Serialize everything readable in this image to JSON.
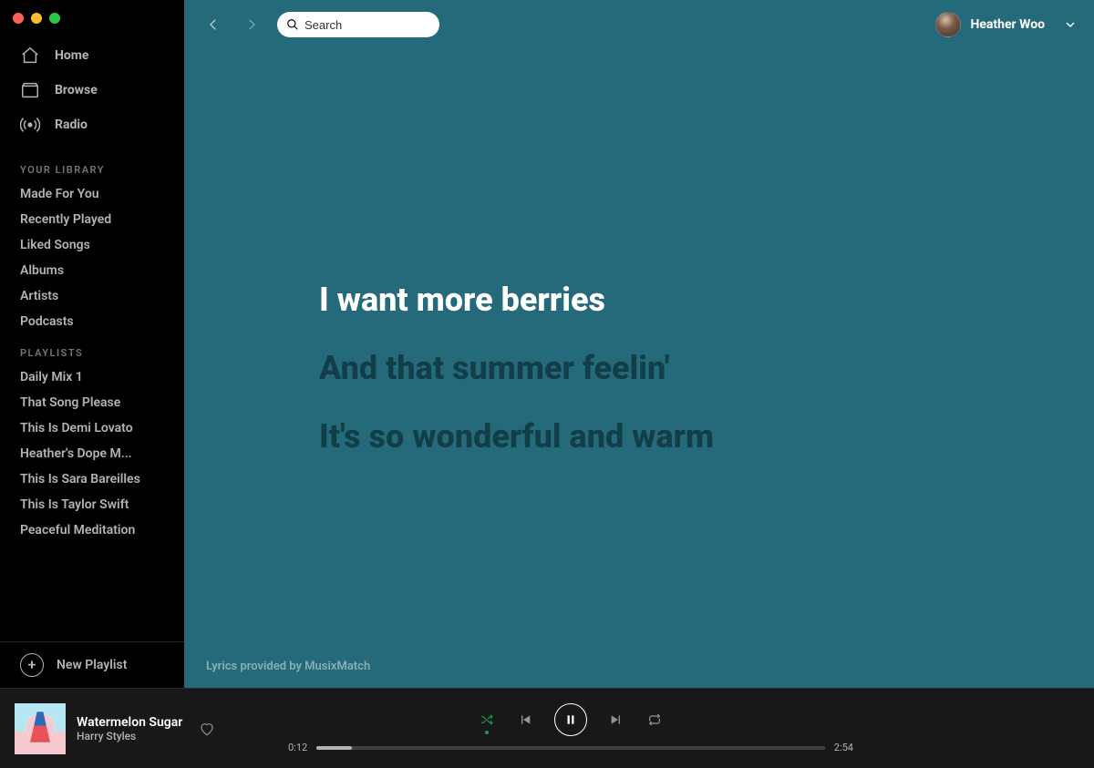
{
  "sidebar": {
    "nav": [
      {
        "label": "Home",
        "icon": "home-icon",
        "active": false
      },
      {
        "label": "Browse",
        "icon": "browse-icon",
        "active": false
      },
      {
        "label": "Radio",
        "icon": "radio-icon",
        "active": false
      }
    ],
    "library_title": "YOUR LIBRARY",
    "library": [
      "Made For You",
      "Recently Played",
      "Liked Songs",
      "Albums",
      "Artists",
      "Podcasts"
    ],
    "playlists_title": "PLAYLISTS",
    "playlists": [
      "Daily Mix 1",
      "That Song Please",
      "This Is Demi Lovato",
      "Heather's Dope M...",
      "This Is Sara Bareilles",
      "This Is Taylor Swift",
      "Peaceful Meditation"
    ],
    "new_playlist": "New Playlist"
  },
  "topbar": {
    "search_placeholder": "Search",
    "user_name": "Heather Woo"
  },
  "lyrics": {
    "lines": [
      {
        "text": "I want more berries",
        "current": true
      },
      {
        "text": "And that summer feelin'",
        "current": false
      },
      {
        "text": "It's so wonderful and warm",
        "current": false
      }
    ],
    "attribution": "Lyrics provided by MusixMatch",
    "bg_color": "#256a7a"
  },
  "player": {
    "title": "Watermelon Sugar",
    "artist": "Harry Styles",
    "elapsed": "0:12",
    "duration": "2:54",
    "progress_pct": 7,
    "shuffle_on": true,
    "repeat_on": false,
    "playing": true,
    "liked": false
  }
}
